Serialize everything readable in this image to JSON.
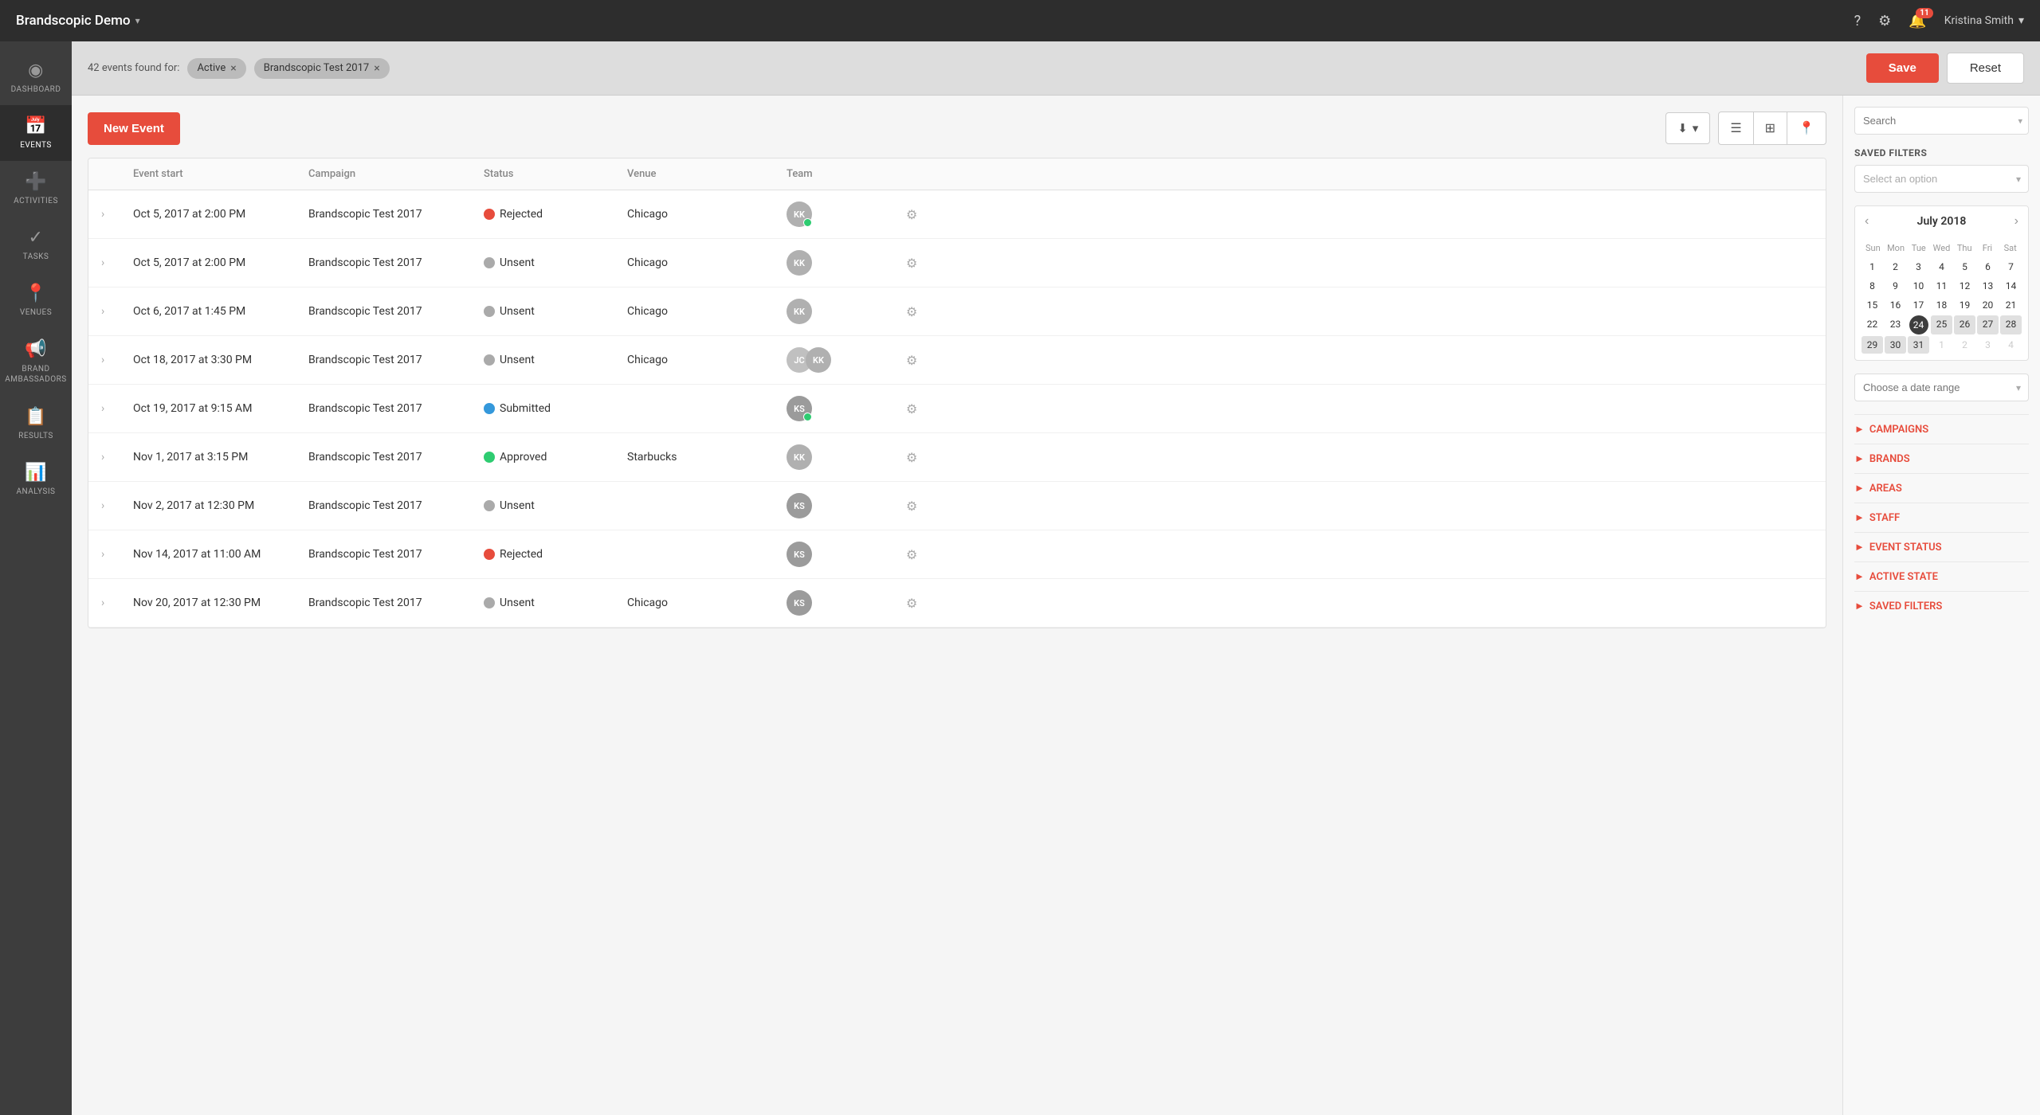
{
  "topNav": {
    "brand": "Brandscopic Demo",
    "helpIcon": "?",
    "settingsIcon": "⚙",
    "notificationCount": "11",
    "userName": "Kristina Smith"
  },
  "sidebar": {
    "items": [
      {
        "id": "dashboard",
        "label": "Dashboard",
        "icon": "◉"
      },
      {
        "id": "events",
        "label": "Events",
        "icon": "📅",
        "active": true
      },
      {
        "id": "activities",
        "label": "Activities",
        "icon": "➕"
      },
      {
        "id": "tasks",
        "label": "Tasks",
        "icon": "✓"
      },
      {
        "id": "venues",
        "label": "Venues",
        "icon": "📍"
      },
      {
        "id": "brand-ambassadors",
        "label": "Brand Ambassadors",
        "icon": "📢"
      },
      {
        "id": "results",
        "label": "Results",
        "icon": "📋"
      },
      {
        "id": "analysis",
        "label": "Analysis",
        "icon": "📊"
      }
    ]
  },
  "filterBar": {
    "eventsCount": "42 events found for:",
    "tags": [
      {
        "label": "Active"
      },
      {
        "label": "Brandscopic Test 2017"
      }
    ],
    "saveLabel": "Save",
    "resetLabel": "Reset"
  },
  "toolbar": {
    "newEventLabel": "New Event",
    "downloadIcon": "⬇",
    "listIcon": "☰",
    "gridIcon": "⊞",
    "locationIcon": "📍"
  },
  "table": {
    "headers": [
      "",
      "Event start",
      "Campaign",
      "Status",
      "Venue",
      "Team",
      ""
    ],
    "rows": [
      {
        "date": "Oct 5, 2017 at 2:00 PM",
        "campaign": "Brandscopic Test 2017",
        "status": "Rejected",
        "statusColor": "#e74c3c",
        "venue": "Chicago",
        "team": "KK",
        "teamOnline": true
      },
      {
        "date": "Oct 5, 2017 at 2:00 PM",
        "campaign": "Brandscopic Test 2017",
        "status": "Unsent",
        "statusColor": "#aaa",
        "venue": "Chicago",
        "team": "KK",
        "teamOnline": false
      },
      {
        "date": "Oct 6, 2017 at 1:45 PM",
        "campaign": "Brandscopic Test 2017",
        "status": "Unsent",
        "statusColor": "#aaa",
        "venue": "Chicago",
        "team": "KK",
        "teamOnline": false
      },
      {
        "date": "Oct 18, 2017 at 3:30 PM",
        "campaign": "Brandscopic Test 2017",
        "status": "Unsent",
        "statusColor": "#aaa",
        "venue": "Chicago",
        "team": "JC+KK",
        "teamOnline": false
      },
      {
        "date": "Oct 19, 2017 at 9:15 AM",
        "campaign": "Brandscopic Test 2017",
        "status": "Submitted",
        "statusColor": "#3498db",
        "venue": "",
        "team": "KS",
        "teamOnline": true
      },
      {
        "date": "Nov 1, 2017 at 3:15 PM",
        "campaign": "Brandscopic Test 2017",
        "status": "Approved",
        "statusColor": "#2ecc71",
        "venue": "Starbucks",
        "team": "KK",
        "teamOnline": false
      },
      {
        "date": "Nov 2, 2017 at 12:30 PM",
        "campaign": "Brandscopic Test 2017",
        "status": "Unsent",
        "statusColor": "#aaa",
        "venue": "",
        "team": "KS",
        "teamOnline": false
      },
      {
        "date": "Nov 14, 2017 at 11:00 AM",
        "campaign": "Brandscopic Test 2017",
        "status": "Rejected",
        "statusColor": "#e74c3c",
        "venue": "",
        "team": "KS",
        "teamOnline": false
      },
      {
        "date": "Nov 20, 2017 at 12:30 PM",
        "campaign": "Brandscopic Test 2017",
        "status": "Unsent",
        "statusColor": "#aaa",
        "venue": "Chicago",
        "team": "KS",
        "teamOnline": false
      }
    ]
  },
  "rightPanel": {
    "searchPlaceholder": "Search",
    "savedFiltersTitle": "SAVED FILTERS",
    "selectAnOption": "Select an option",
    "calendarTitle": "July 2018",
    "calendar": {
      "dayNames": [
        "Sun",
        "Mon",
        "Tue",
        "Wed",
        "Thu",
        "Fri",
        "Sat"
      ],
      "weeks": [
        [
          {
            "day": "1",
            "type": "normal"
          },
          {
            "day": "2",
            "type": "normal"
          },
          {
            "day": "3",
            "type": "normal"
          },
          {
            "day": "4",
            "type": "normal"
          },
          {
            "day": "5",
            "type": "normal"
          },
          {
            "day": "6",
            "type": "normal"
          },
          {
            "day": "7",
            "type": "normal"
          }
        ],
        [
          {
            "day": "8",
            "type": "normal"
          },
          {
            "day": "9",
            "type": "normal"
          },
          {
            "day": "10",
            "type": "normal"
          },
          {
            "day": "11",
            "type": "normal"
          },
          {
            "day": "12",
            "type": "normal"
          },
          {
            "day": "13",
            "type": "normal"
          },
          {
            "day": "14",
            "type": "normal"
          }
        ],
        [
          {
            "day": "15",
            "type": "normal"
          },
          {
            "day": "16",
            "type": "normal"
          },
          {
            "day": "17",
            "type": "normal"
          },
          {
            "day": "18",
            "type": "normal"
          },
          {
            "day": "19",
            "type": "normal"
          },
          {
            "day": "20",
            "type": "normal"
          },
          {
            "day": "21",
            "type": "normal"
          }
        ],
        [
          {
            "day": "22",
            "type": "normal"
          },
          {
            "day": "23",
            "type": "normal"
          },
          {
            "day": "24",
            "type": "today"
          },
          {
            "day": "25",
            "type": "highlight"
          },
          {
            "day": "26",
            "type": "highlight"
          },
          {
            "day": "27",
            "type": "highlight"
          },
          {
            "day": "28",
            "type": "highlight"
          }
        ],
        [
          {
            "day": "29",
            "type": "highlight"
          },
          {
            "day": "30",
            "type": "highlight"
          },
          {
            "day": "31",
            "type": "highlight"
          },
          {
            "day": "1",
            "type": "other-month"
          },
          {
            "day": "2",
            "type": "other-month"
          },
          {
            "day": "3",
            "type": "other-month"
          },
          {
            "day": "4",
            "type": "other-month"
          }
        ]
      ]
    },
    "dateRangePlaceholder": "Choose a date range",
    "accordionItems": [
      "CAMPAIGNS",
      "BRANDS",
      "AREAS",
      "STAFF",
      "EVENT STATUS",
      "ACTIVE STATE",
      "SAVED FILTERS"
    ]
  }
}
